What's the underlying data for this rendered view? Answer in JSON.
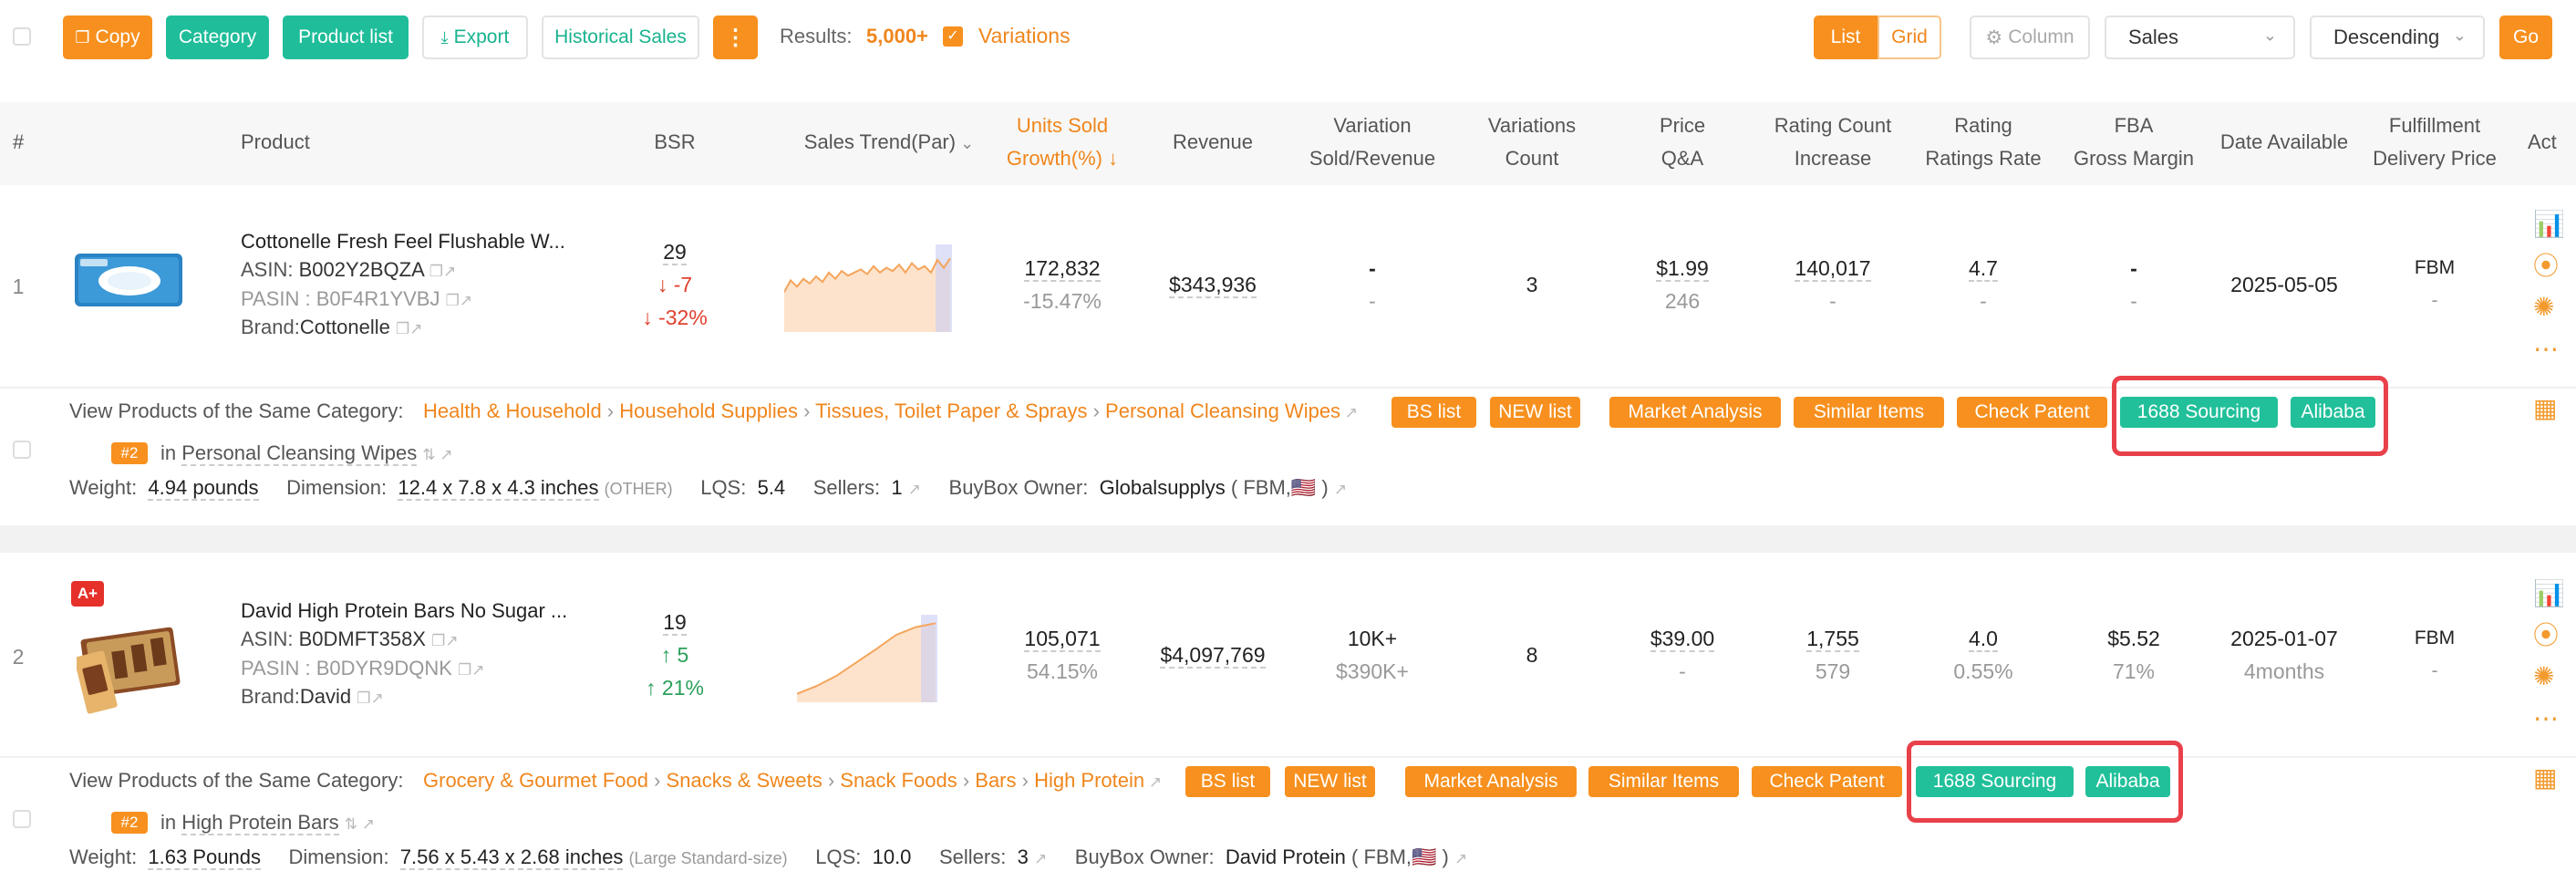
{
  "toolbar": {
    "copy": "Copy",
    "category": "Category",
    "product_list": "Product list",
    "export": "Export",
    "historical_sales": "Historical Sales",
    "more": "⋮",
    "results_label": "Results:",
    "results_value": "5,000+",
    "variations_label": "Variations",
    "variations_checked": true,
    "list": "List",
    "grid": "Grid",
    "column": "Column",
    "sort_by": "Sales",
    "order": "Descending",
    "go": "Go"
  },
  "headers": {
    "num": "#",
    "product": "Product",
    "bsr": "BSR",
    "sales_trend": "Sales Trend(Par)",
    "units_sold_1": "Units Sold",
    "units_sold_2": "Growth(%)",
    "revenue": "Revenue",
    "var_sold_1": "Variation",
    "var_sold_2": "Sold/Revenue",
    "var_count_1": "Variations",
    "var_count_2": "Count",
    "price_1": "Price",
    "price_2": "Q&A",
    "rating_count_1": "Rating Count",
    "rating_count_2": "Increase",
    "rating_1": "Rating",
    "rating_2": "Ratings Rate",
    "fba_1": "FBA",
    "fba_2": "Gross Margin",
    "date": "Date Available",
    "fulfill_1": "Fulfillment",
    "fulfill_2": "Delivery Price",
    "act": "Act"
  },
  "common": {
    "view_same_category": "View Products of the Same Category:",
    "in": "in",
    "weight_label": "Weight:",
    "dimension_label": "Dimension:",
    "lqs_label": "LQS:",
    "sellers_label": "Sellers:",
    "buybox_label": "BuyBox Owner:",
    "asin_label": "ASIN:",
    "pasin_label": "PASIN :",
    "brand_label": "Brand:",
    "bs_list": "BS list",
    "new_list": "NEW list",
    "market_analysis": "Market Analysis",
    "similar_items": "Similar Items",
    "check_patent": "Check Patent",
    "sourcing": "1688 Sourcing",
    "alibaba": "Alibaba",
    "accent_orange": "#f7901e",
    "accent_teal": "#1fbd9a",
    "highlight_red": "#e8414a"
  },
  "rows": [
    {
      "index": "1",
      "title": "Cottonelle Fresh Feel Flushable W...",
      "asin": "B002Y2BQZA",
      "pasin": "B0F4R1YVBJ",
      "brand": "Cottonelle",
      "badge": "",
      "bsr": "29",
      "bsr_change": "↓ -7",
      "bsr_pct": "↓ -32%",
      "units": "172,832",
      "growth": "-15.47%",
      "revenue": "$343,936",
      "var_sold": "-",
      "var_revenue": "-",
      "var_count": "3",
      "price": "$1.99",
      "qa": "246",
      "rating_count": "140,017",
      "rating_increase": "-",
      "rating": "4.7",
      "ratings_rate": "-",
      "fba": "-",
      "gross_margin": "-",
      "date": "2025-05-05",
      "date_sub": "",
      "fulfillment": "FBM",
      "delivery": "-",
      "categories": [
        "Health & Household",
        "Household Supplies",
        "Tissues, Toilet Paper & Sprays",
        "Personal Cleansing Wipes"
      ],
      "rank": "#2",
      "rank_category": "Personal Cleansing Wipes",
      "weight": "4.94 pounds",
      "dimension": "12.4 x 7.8 x 4.3 inches",
      "size_tier": "(OTHER)",
      "lqs": "5.4",
      "sellers": "1",
      "buybox": "Globalsupplys",
      "buybox_meta": "( FBM,🇺🇸 )",
      "trend": [
        0.55,
        0.4,
        0.48,
        0.38,
        0.44,
        0.35,
        0.42,
        0.3,
        0.38,
        0.28,
        0.34,
        0.3,
        0.26,
        0.32,
        0.22,
        0.3,
        0.24,
        0.28,
        0.2,
        0.3,
        0.18,
        0.26,
        0.22,
        0.3,
        0.14,
        0.24,
        0.12
      ]
    },
    {
      "index": "2",
      "title": "David High Protein Bars No Sugar ...",
      "asin": "B0DMFT358X",
      "pasin": "B0DYR9DQNK",
      "brand": "David",
      "badge": "A+",
      "bsr": "19",
      "bsr_change": "↑ 5",
      "bsr_pct": "↑ 21%",
      "units": "105,071",
      "growth": "54.15%",
      "revenue": "$4,097,769",
      "var_sold": "10K+",
      "var_revenue": "$390K+",
      "var_count": "8",
      "price": "$39.00",
      "qa": "-",
      "rating_count": "1,755",
      "rating_increase": "579",
      "rating": "4.0",
      "ratings_rate": "0.55%",
      "fba": "$5.52",
      "gross_margin": "71%",
      "date": "2025-01-07",
      "date_sub": "4months",
      "fulfillment": "FBM",
      "delivery": "-",
      "categories": [
        "Grocery & Gourmet Food",
        "Snacks & Sweets",
        "Snack Foods",
        "Bars",
        "High Protein"
      ],
      "rank": "#2",
      "rank_category": "High Protein Bars",
      "weight": "1.63 Pounds",
      "dimension": "7.56 x 5.43 x 2.68 inches",
      "size_tier": "(Large Standard-size)",
      "lqs": "10.0",
      "sellers": "3",
      "buybox": "David Protein",
      "buybox_meta": "( FBM,🇺🇸 )",
      "trend": [
        0.95,
        0.85,
        0.72,
        0.55,
        0.38,
        0.2,
        0.1,
        0.05
      ]
    }
  ]
}
